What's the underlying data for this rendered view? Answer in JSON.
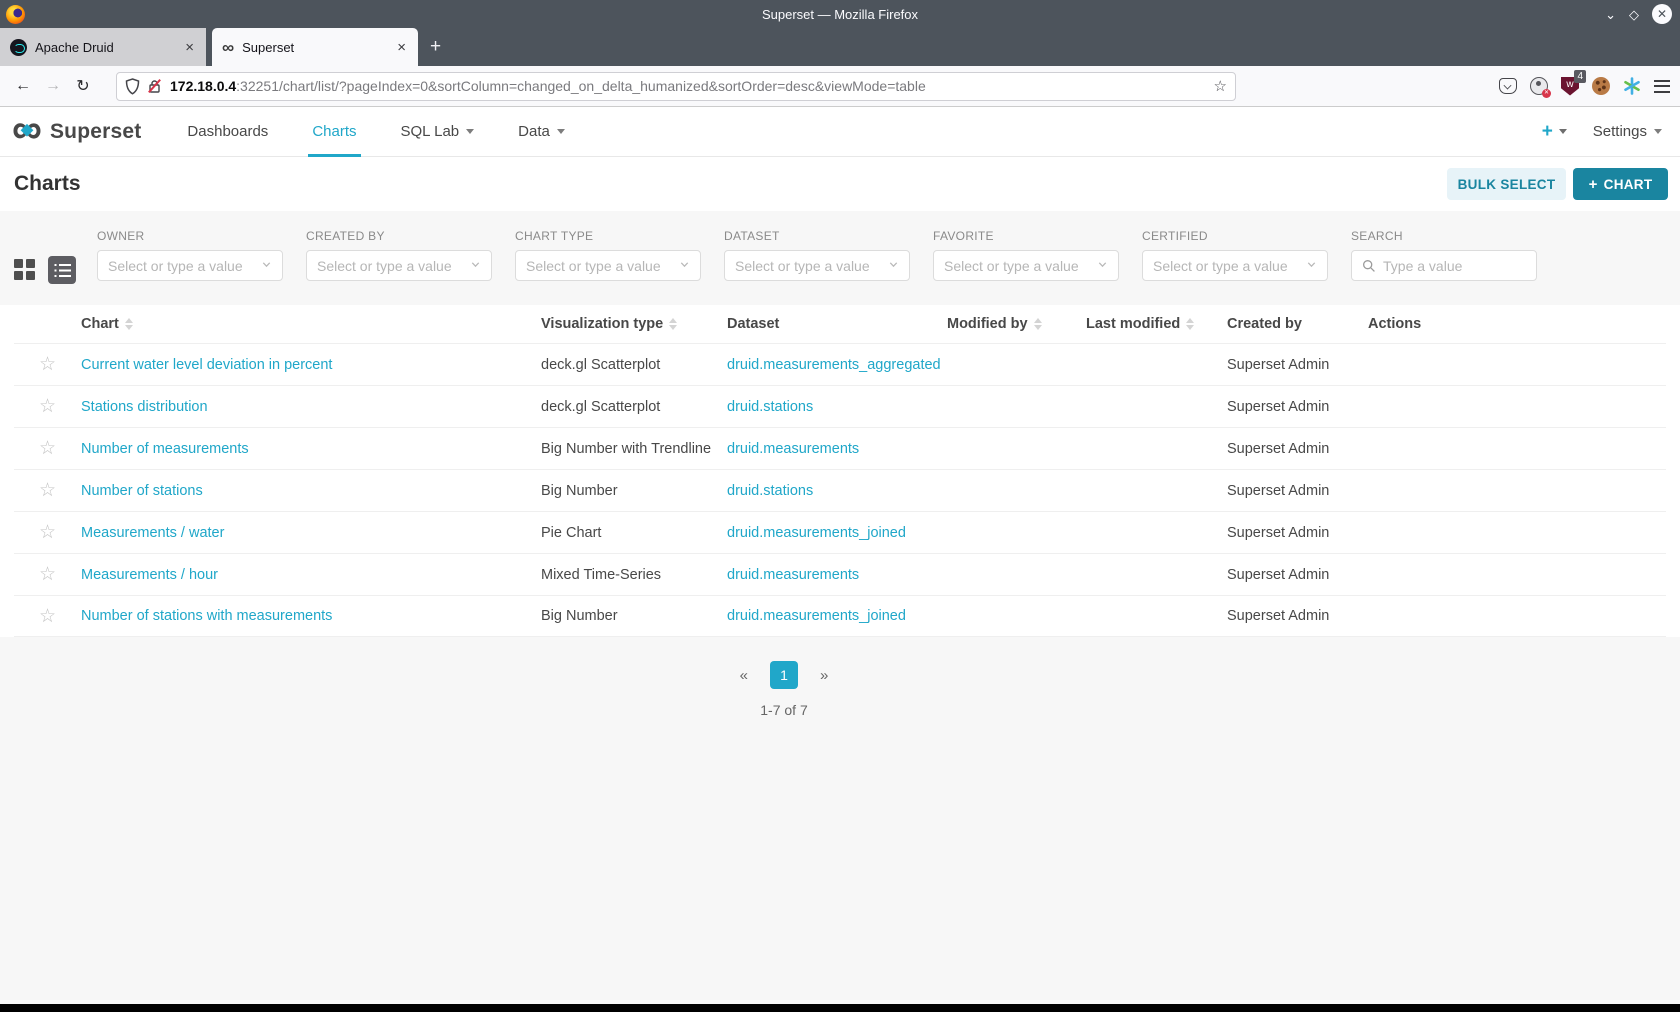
{
  "browser": {
    "window_title": "Superset — Mozilla Firefox",
    "tabs": [
      {
        "title": "Apache Druid"
      },
      {
        "title": "Superset"
      }
    ],
    "tab_close_glyph": "×",
    "new_tab_glyph": "+",
    "back_glyph": "←",
    "forward_glyph": "→",
    "reload_glyph": "↻",
    "bookmark_star_glyph": "☆",
    "url": {
      "host": "172.18.0.4",
      "rest": ":32251/chart/list/?pageIndex=0&sortColumn=changed_on_delta_humanized&sortOrder=desc&viewMode=table"
    },
    "extension_badge": "4",
    "extension_shield_letter": "w"
  },
  "app": {
    "brand": "Superset",
    "brand_glyph": "∞",
    "nav": {
      "dashboards": "Dashboards",
      "charts": "Charts",
      "sql_lab": "SQL Lab",
      "data": "Data",
      "plus": "+",
      "settings": "Settings"
    },
    "page_title": "Charts",
    "bulk_select_label": "BULK SELECT",
    "add_chart_plus": "+",
    "add_chart_label": "CHART"
  },
  "filters": [
    {
      "label": "OWNER",
      "placeholder": "Select or type a value",
      "type": "select"
    },
    {
      "label": "CREATED BY",
      "placeholder": "Select or type a value",
      "type": "select"
    },
    {
      "label": "CHART TYPE",
      "placeholder": "Select or type a value",
      "type": "select"
    },
    {
      "label": "DATASET",
      "placeholder": "Select or type a value",
      "type": "select"
    },
    {
      "label": "FAVORITE",
      "placeholder": "Select or type a value",
      "type": "select"
    },
    {
      "label": "CERTIFIED",
      "placeholder": "Select or type a value",
      "type": "select"
    },
    {
      "label": "SEARCH",
      "placeholder": "Type a value",
      "type": "search"
    }
  ],
  "table": {
    "columns": [
      {
        "label": "Chart",
        "sortable": true
      },
      {
        "label": "Visualization type",
        "sortable": true
      },
      {
        "label": "Dataset",
        "sortable": false
      },
      {
        "label": "Modified by",
        "sortable": true
      },
      {
        "label": "Last modified",
        "sortable": true
      },
      {
        "label": "Created by",
        "sortable": false
      },
      {
        "label": "Actions",
        "sortable": false
      }
    ],
    "favorite_star_glyph": "☆",
    "rows": [
      {
        "chart": "Current water level deviation in percent",
        "viz_type": "deck.gl Scatterplot",
        "dataset": "druid.measurements_aggregated",
        "modified_by": "",
        "last_modified": "",
        "created_by": "Superset Admin",
        "actions": ""
      },
      {
        "chart": "Stations distribution",
        "viz_type": "deck.gl Scatterplot",
        "dataset": "druid.stations",
        "modified_by": "",
        "last_modified": "",
        "created_by": "Superset Admin",
        "actions": ""
      },
      {
        "chart": "Number of measurements",
        "viz_type": "Big Number with Trendline",
        "dataset": "druid.measurements",
        "modified_by": "",
        "last_modified": "",
        "created_by": "Superset Admin",
        "actions": ""
      },
      {
        "chart": "Number of stations",
        "viz_type": "Big Number",
        "dataset": "druid.stations",
        "modified_by": "",
        "last_modified": "",
        "created_by": "Superset Admin",
        "actions": ""
      },
      {
        "chart": "Measurements / water",
        "viz_type": "Pie Chart",
        "dataset": "druid.measurements_joined",
        "modified_by": "",
        "last_modified": "",
        "created_by": "Superset Admin",
        "actions": ""
      },
      {
        "chart": "Measurements / hour",
        "viz_type": "Mixed Time-Series",
        "dataset": "druid.measurements",
        "modified_by": "",
        "last_modified": "",
        "created_by": "Superset Admin",
        "actions": ""
      },
      {
        "chart": "Number of stations with measurements",
        "viz_type": "Big Number",
        "dataset": "druid.measurements_joined",
        "modified_by": "",
        "last_modified": "",
        "created_by": "Superset Admin",
        "actions": ""
      }
    ]
  },
  "pagination": {
    "prev": "«",
    "page": "1",
    "next": "»",
    "summary": "1-7 of 7"
  },
  "colors": {
    "accent": "#20a7c9",
    "primary_button": "#1a85a0",
    "link": "#20a7c9",
    "titlebar": "#4d545c",
    "filter_bar_bg": "#f7f7f7"
  }
}
